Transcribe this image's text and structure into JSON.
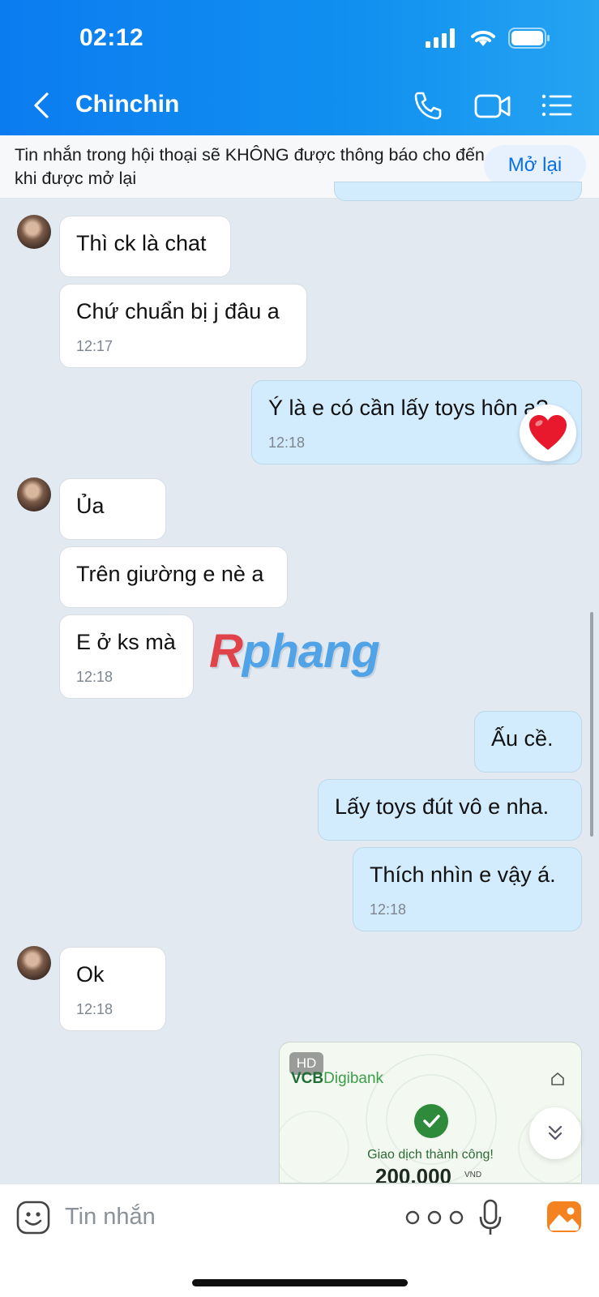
{
  "status_bar": {
    "time": "02:12"
  },
  "header": {
    "title": "Chinchin"
  },
  "notice": {
    "text": "Tin nhắn trong hội thoại sẽ KHÔNG được thông báo cho đến khi được mở lại",
    "button": "Mở lại"
  },
  "messages": [
    {
      "side": "in",
      "text": "Thì ck là chat"
    },
    {
      "side": "in",
      "text": "Chứ chuẩn bị j đâu a",
      "time": "12:17"
    },
    {
      "side": "out",
      "text": "Ý là e có cần lấy toys hôn a?",
      "time": "12:18",
      "reaction": "heart"
    },
    {
      "side": "in",
      "text": "Ủa"
    },
    {
      "side": "in",
      "text": "Trên giường e nè a"
    },
    {
      "side": "in",
      "text": "E ở ks mà",
      "time": "12:18"
    },
    {
      "side": "out",
      "text": "Ấu cề."
    },
    {
      "side": "out",
      "text": "Lấy toys đút vô e nha."
    },
    {
      "side": "out",
      "text": "Thích nhìn e vậy á.",
      "time": "12:18"
    },
    {
      "side": "in",
      "text": "Ok",
      "time": "12:18"
    }
  ],
  "watermark": {
    "r": "R",
    "rest": "phang"
  },
  "image_card": {
    "badge": "HD",
    "bank_vcb": "VCB",
    "bank_digibank": "Digibank",
    "status": "Giao dịch thành công!",
    "amount": "200.000",
    "currency": "VND"
  },
  "input": {
    "placeholder": "Tin nhắn"
  },
  "colors": {
    "header_gradient_start": "#0b7cf0",
    "header_gradient_end": "#25a4f2",
    "outgoing_bubble": "#d3ecfd",
    "incoming_bubble": "#ffffff",
    "chat_bg": "#e2e9f1"
  },
  "icons": [
    "back-icon",
    "phone-icon",
    "video-icon",
    "menu-icon",
    "heart-icon",
    "chevron-double-down-icon",
    "emoji-icon",
    "more-icon",
    "mic-icon",
    "gallery-icon"
  ]
}
